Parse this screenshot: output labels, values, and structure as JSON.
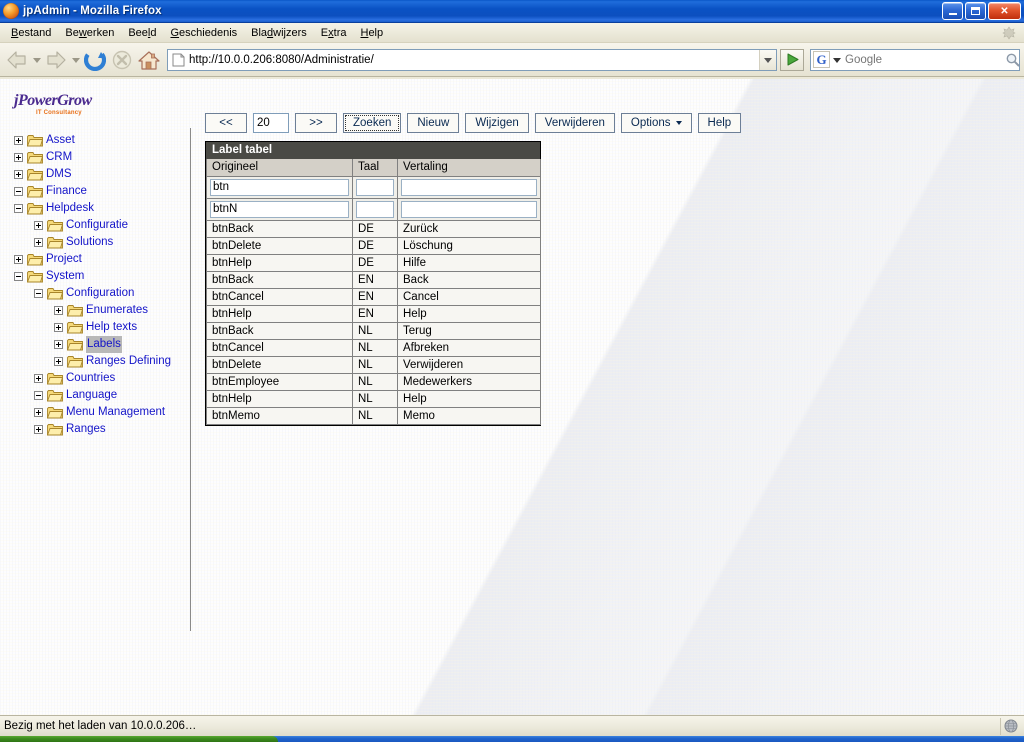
{
  "window": {
    "title": "jpAdmin - Mozilla Firefox",
    "minimize_label": "Minimize",
    "maximize_label": "Maximize",
    "close_label": "Close"
  },
  "menubar": {
    "items": [
      {
        "label": "Bestand",
        "accel": "B"
      },
      {
        "label": "Bewerken",
        "accel": "w"
      },
      {
        "label": "Beeld",
        "accel": "l"
      },
      {
        "label": "Geschiedenis",
        "accel": "G"
      },
      {
        "label": "Bladwijzers",
        "accel": "d"
      },
      {
        "label": "Extra",
        "accel": "x"
      },
      {
        "label": "Help",
        "accel": "H"
      }
    ]
  },
  "navbar": {
    "back_label": "Terug",
    "forward_label": "Vooruit",
    "reload_label": "Herladen",
    "stop_label": "Stoppen",
    "home_label": "Startpagina",
    "url": "http://10.0.0.206:8080/Administratie/",
    "go_label": "Ga",
    "search_engine": "G",
    "search_placeholder": "Google",
    "search_value": ""
  },
  "sidebar": {
    "logo_script": "jPowerGrow",
    "logo_sub": "IT Consultancy",
    "tree": [
      {
        "label": "Asset",
        "depth": 0,
        "state": "collapsed"
      },
      {
        "label": "CRM",
        "depth": 0,
        "state": "collapsed"
      },
      {
        "label": "DMS",
        "depth": 0,
        "state": "collapsed"
      },
      {
        "label": "Finance",
        "depth": 0,
        "state": "expanded"
      },
      {
        "label": "Helpdesk",
        "depth": 0,
        "state": "expanded"
      },
      {
        "label": "Configuratie",
        "depth": 1,
        "state": "collapsed"
      },
      {
        "label": "Solutions",
        "depth": 1,
        "state": "collapsed"
      },
      {
        "label": "Project",
        "depth": 0,
        "state": "collapsed"
      },
      {
        "label": "System",
        "depth": 0,
        "state": "expanded"
      },
      {
        "label": "Configuration",
        "depth": 1,
        "state": "expanded"
      },
      {
        "label": "Enumerates",
        "depth": 2,
        "state": "collapsed"
      },
      {
        "label": "Help texts",
        "depth": 2,
        "state": "collapsed"
      },
      {
        "label": "Labels",
        "depth": 2,
        "state": "collapsed",
        "selected": true
      },
      {
        "label": "Ranges Defining",
        "depth": 2,
        "state": "collapsed"
      },
      {
        "label": "Countries",
        "depth": 1,
        "state": "collapsed"
      },
      {
        "label": "Language",
        "depth": 1,
        "state": "expanded"
      },
      {
        "label": "Menu Management",
        "depth": 1,
        "state": "collapsed"
      },
      {
        "label": "Ranges",
        "depth": 1,
        "state": "collapsed"
      }
    ]
  },
  "toolbar": {
    "prev_label": "<<",
    "page_size": "20",
    "next_label": ">>",
    "search_label": "Zoeken",
    "new_label": "Nieuw",
    "edit_label": "Wijzigen",
    "delete_label": "Verwijderen",
    "options_label": "Options",
    "help_label": "Help"
  },
  "table": {
    "title": "Label tabel",
    "columns": [
      "Origineel",
      "Taal",
      "Vertaling"
    ],
    "filter_rows": [
      {
        "origineel": "btn",
        "taal": "",
        "vertaling": ""
      },
      {
        "origineel": "btnN",
        "taal": "",
        "vertaling": ""
      }
    ],
    "rows": [
      {
        "origineel": "btnBack",
        "taal": "DE",
        "vertaling": "Zurück"
      },
      {
        "origineel": "btnDelete",
        "taal": "DE",
        "vertaling": "Löschung"
      },
      {
        "origineel": "btnHelp",
        "taal": "DE",
        "vertaling": "Hilfe"
      },
      {
        "origineel": "btnBack",
        "taal": "EN",
        "vertaling": "Back"
      },
      {
        "origineel": "btnCancel",
        "taal": "EN",
        "vertaling": "Cancel"
      },
      {
        "origineel": "btnHelp",
        "taal": "EN",
        "vertaling": "Help"
      },
      {
        "origineel": "btnBack",
        "taal": "NL",
        "vertaling": "Terug"
      },
      {
        "origineel": "btnCancel",
        "taal": "NL",
        "vertaling": "Afbreken"
      },
      {
        "origineel": "btnDelete",
        "taal": "NL",
        "vertaling": "Verwijderen"
      },
      {
        "origineel": "btnEmployee",
        "taal": "NL",
        "vertaling": "Medewerkers"
      },
      {
        "origineel": "btnHelp",
        "taal": "NL",
        "vertaling": "Help"
      },
      {
        "origineel": "btnMemo",
        "taal": "NL",
        "vertaling": "Memo"
      }
    ]
  },
  "statusbar": {
    "text": "Bezig met het laden van 10.0.0.206…"
  },
  "colors": {
    "titlebar_blue": "#0c4fbf",
    "tree_link": "#1414c8",
    "table_header_bg": "#4a4a45",
    "column_header_bg": "#d4d0c8",
    "button_border": "#6d7f96",
    "selection_bg": "#b8b8b8"
  }
}
